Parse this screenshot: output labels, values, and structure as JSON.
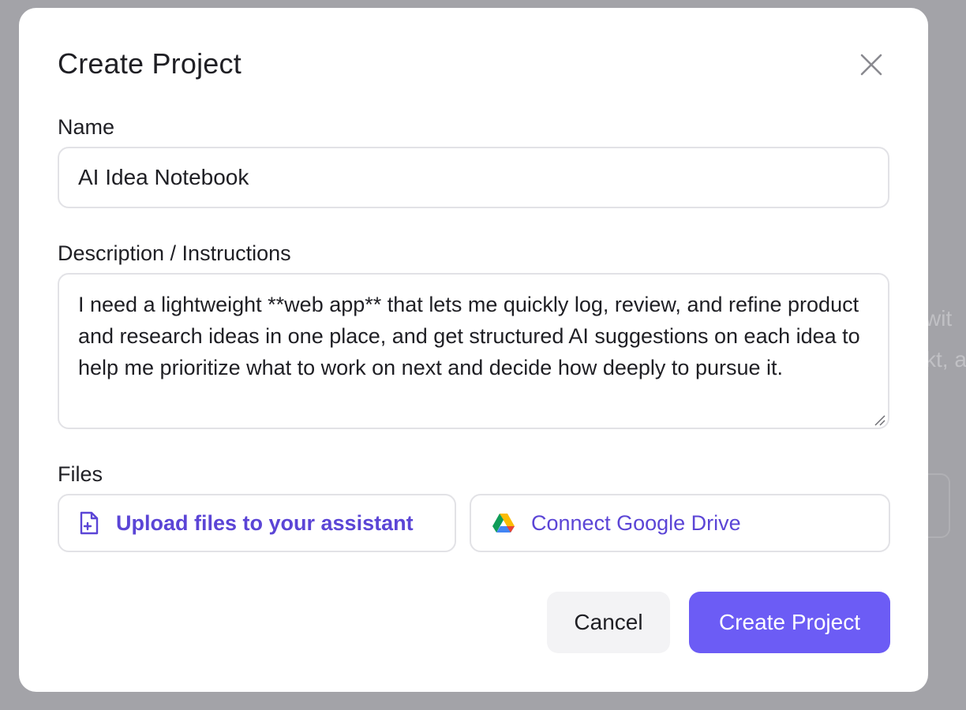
{
  "background": {
    "text_line_1": "wit",
    "text_line_2": "kt, a"
  },
  "modal": {
    "title": "Create Project",
    "close_icon": "close-icon",
    "name_label": "Name",
    "name_value": "AI Idea Notebook",
    "description_label": "Description / Instructions",
    "description_value": "I need a lightweight **web app** that lets me quickly log, review, and refine product and research ideas in one place, and get structured AI suggestions on each idea to help me prioritize what to work on next and decide how deeply to pursue it.",
    "files_label": "Files",
    "upload_label": "Upload files to your assistant",
    "upload_icon": "file-plus-icon",
    "drive_label": "Connect Google Drive",
    "drive_icon": "google-drive-icon",
    "cancel_label": "Cancel",
    "create_label": "Create Project"
  },
  "colors": {
    "accent": "#6c5cf5",
    "link": "#5b45d6",
    "overlay": "#9c9ca1"
  }
}
